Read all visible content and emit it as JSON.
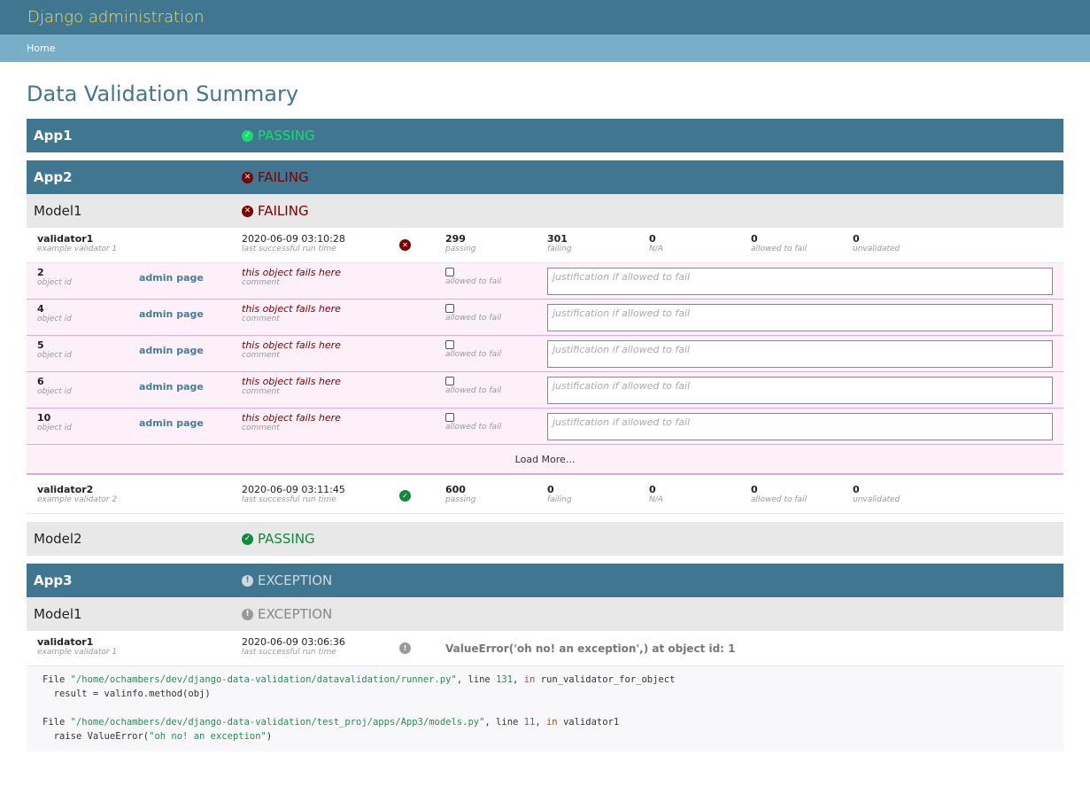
{
  "header": {
    "title": "Django administration"
  },
  "breadcrumbs": {
    "home": "Home"
  },
  "page": {
    "title": "Data Validation Summary"
  },
  "apps": {
    "app1": {
      "name": "App1",
      "status": "PASSING"
    },
    "app2": {
      "name": "App2",
      "status": "FAILING",
      "model1": {
        "name": "Model1",
        "status": "FAILING",
        "validator1": {
          "name": "validator1",
          "desc": "example validator 1",
          "time": "2020-06-09 03:10:28",
          "time_label": "last successful run time",
          "passing": "299",
          "failing": "301",
          "na": "0",
          "allowed": "0",
          "unvalidated": "0",
          "failures": [
            {
              "id": "2",
              "link": "admin page",
              "comment": "this object fails here"
            },
            {
              "id": "4",
              "link": "admin page",
              "comment": "this object fails here"
            },
            {
              "id": "5",
              "link": "admin page",
              "comment": "this object fails here"
            },
            {
              "id": "6",
              "link": "admin page",
              "comment": "this object fails here"
            },
            {
              "id": "10",
              "link": "admin page",
              "comment": "this object fails here"
            }
          ],
          "load_more": "Load More..."
        },
        "validator2": {
          "name": "validator2",
          "desc": "example validator 2",
          "time": "2020-06-09 03:11:45",
          "time_label": "last successful run time",
          "passing": "600",
          "failing": "0",
          "na": "0",
          "allowed": "0",
          "unvalidated": "0"
        }
      },
      "model2": {
        "name": "Model2",
        "status": "PASSING"
      }
    },
    "app3": {
      "name": "App3",
      "status": "EXCEPTION",
      "model1": {
        "name": "Model1",
        "status": "EXCEPTION",
        "validator1": {
          "name": "validator1",
          "desc": "example validator 1",
          "time": "2020-06-09 03:06:36",
          "time_label": "last successful run time",
          "exception": "ValueError('oh no! an exception',) at object id: 1"
        }
      }
    }
  },
  "labels": {
    "passing": "passing",
    "failing": "failing",
    "na": "N/A",
    "allowed": "allowed to fail",
    "unvalidated": "unvalidated",
    "object_id": "object id",
    "comment": "comment",
    "allowed_cb": "allowed to fail",
    "justification": "justification if allowed to fail"
  },
  "traceback": {
    "file1": "\"/home/ochambers/dev/django-data-validation/datavalidation/runner.py\"",
    "line1": "131",
    "func1": "run_validator_for_object",
    "code1": "result = valinfo.method(obj)",
    "file2": "\"/home/ochambers/dev/django-data-validation/test_proj/apps/App3/models.py\"",
    "line2": "11",
    "func2": "validator1",
    "code2a": "raise ValueError(",
    "code2b": "\"oh no! an exception\"",
    "code2c": ")"
  },
  "colors": {
    "header": "#417690",
    "breadcrumbs": "#79aec8",
    "brand": "#f5dd5d",
    "fail": "#7a0000",
    "pass": "#0d8a3e",
    "exception": "#999999"
  },
  "icons": {
    "pass": "check-circle-icon",
    "fail": "x-circle-icon",
    "exception": "exclamation-circle-icon"
  }
}
